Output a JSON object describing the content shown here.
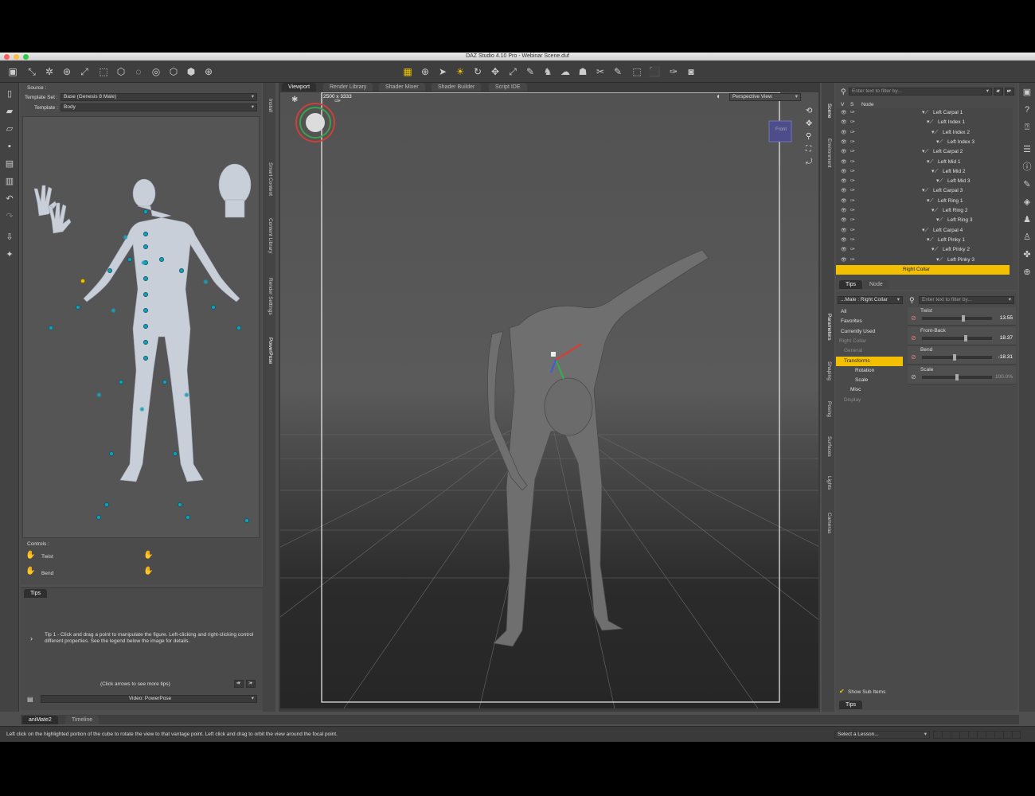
{
  "window": {
    "title": "DAZ Studio 4.10 Pro - Webinar Scene.duf"
  },
  "toolbar": {
    "icons": [
      "scene-icon",
      "bone-icon",
      "joint-icon",
      "rotate-tool-icon",
      "node-icon",
      "transform-icon",
      "cube-icon",
      "sphere-icon",
      "target-icon",
      "mesh-icon",
      "geometry-icon",
      "render-icon"
    ]
  },
  "center_tools": {
    "icons": [
      "grid-icon",
      "universal-tool-icon",
      "pointer-icon",
      "active-pose-icon",
      "rotate-icon",
      "translate-icon",
      "scale-icon",
      "joint-editor-icon",
      "figure-icon",
      "morph-icon",
      "bone-icon",
      "node-weight-icon",
      "geometry-editor-icon",
      "spot-render-icon",
      "surface-icon",
      "camera-icon"
    ]
  },
  "left_panel": {
    "source_label": "Source :",
    "template_set_label": "Template Set :",
    "template_set_value": "Base (Genesis 8 Male)",
    "template_label": "Template :",
    "template_value": "Body",
    "controls_label": "Controls :",
    "twist_label": "Twist",
    "bend_label": "Bend",
    "vertical_tabs": [
      "Install",
      "Smart Content",
      "Content Library",
      "Render Settings",
      "PowerPose"
    ],
    "tips_tab": "Tips",
    "tip_text": "Tip 1 - Click and drag a point to manipulate the figure. Left-clicking and right-clicking control different properties. See the legend below the image for details.",
    "click_arrows": "(Click arrows to see more tips)",
    "prev": "<",
    "next": ">",
    "video": "Video: PowerPose"
  },
  "viewport": {
    "tabs": [
      "Viewport",
      "Render Library",
      "Shader Mixer",
      "Shader Builder",
      "Script IDE"
    ],
    "resolution": "2500 x 3333",
    "view_label": "Perspective View",
    "cube_label": "Front"
  },
  "scene": {
    "filter_placeholder": "Enter text to filter by...",
    "col_v": "V",
    "col_s": "S",
    "col_node": "Node",
    "nodes": [
      {
        "label": "Left Carpal 1",
        "depth": 0
      },
      {
        "label": "Left Index 1",
        "depth": 1
      },
      {
        "label": "Left Index 2",
        "depth": 2
      },
      {
        "label": "Left Index 3",
        "depth": 3
      },
      {
        "label": "Left Carpal 2",
        "depth": 0
      },
      {
        "label": "Left Mid 1",
        "depth": 1
      },
      {
        "label": "Left Mid 2",
        "depth": 2
      },
      {
        "label": "Left Mid 3",
        "depth": 3
      },
      {
        "label": "Left Carpal 3",
        "depth": 0
      },
      {
        "label": "Left Ring 1",
        "depth": 1
      },
      {
        "label": "Left Ring 2",
        "depth": 2
      },
      {
        "label": "Left Ring 3",
        "depth": 3
      },
      {
        "label": "Left Carpal 4",
        "depth": 0
      },
      {
        "label": "Left Pinky 1",
        "depth": 1
      },
      {
        "label": "Left Pinky 2",
        "depth": 2
      },
      {
        "label": "Left Pinky 3",
        "depth": 3
      }
    ],
    "selected": "Right Collar",
    "bottom_tabs": [
      "Tips",
      "Node"
    ],
    "side_tabs": [
      "Scene",
      "Environment"
    ]
  },
  "params": {
    "node_select": "...Male : Right Collar",
    "filter_placeholder": "Enter text to filter by...",
    "tree": [
      "All",
      "Favorites",
      "Currently Used",
      "Right Collar",
      "General",
      "Transforms",
      "Rotation",
      "Scale",
      "Misc",
      "Display"
    ],
    "selected": "Transforms",
    "sliders": [
      {
        "name": "Twist",
        "value": "13.55",
        "fraction": 0.6
      },
      {
        "name": "Front-Back",
        "value": "18.37",
        "fraction": 0.63
      },
      {
        "name": "Bend",
        "value": "-18.31",
        "fraction": 0.47
      },
      {
        "name": "Scale",
        "value": "100.0%",
        "fraction": 0.5
      }
    ],
    "show_sub_items": "Show Sub Items",
    "tips_tab": "Tips",
    "side_tabs": [
      "Parameters",
      "Shaping",
      "Posing",
      "Surfaces",
      "Lights",
      "Cameras"
    ]
  },
  "bottom": {
    "tabs": [
      "aniMate2",
      "Timeline"
    ],
    "status": "Left click on the highlighted portion of the cube to rotate the view to that vantage point. Left click and drag to orbit the view around the focal point.",
    "lesson": "Select a Lesson..."
  }
}
